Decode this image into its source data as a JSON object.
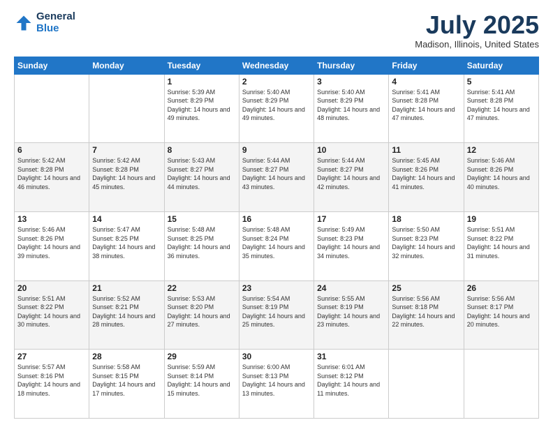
{
  "header": {
    "logo": {
      "general": "General",
      "blue": "Blue"
    },
    "title": "July 2025",
    "location": "Madison, Illinois, United States"
  },
  "days_of_week": [
    "Sunday",
    "Monday",
    "Tuesday",
    "Wednesday",
    "Thursday",
    "Friday",
    "Saturday"
  ],
  "weeks": [
    [
      {
        "day": "",
        "info": ""
      },
      {
        "day": "",
        "info": ""
      },
      {
        "day": "1",
        "info": "Sunrise: 5:39 AM\nSunset: 8:29 PM\nDaylight: 14 hours and 49 minutes."
      },
      {
        "day": "2",
        "info": "Sunrise: 5:40 AM\nSunset: 8:29 PM\nDaylight: 14 hours and 49 minutes."
      },
      {
        "day": "3",
        "info": "Sunrise: 5:40 AM\nSunset: 8:29 PM\nDaylight: 14 hours and 48 minutes."
      },
      {
        "day": "4",
        "info": "Sunrise: 5:41 AM\nSunset: 8:28 PM\nDaylight: 14 hours and 47 minutes."
      },
      {
        "day": "5",
        "info": "Sunrise: 5:41 AM\nSunset: 8:28 PM\nDaylight: 14 hours and 47 minutes."
      }
    ],
    [
      {
        "day": "6",
        "info": "Sunrise: 5:42 AM\nSunset: 8:28 PM\nDaylight: 14 hours and 46 minutes."
      },
      {
        "day": "7",
        "info": "Sunrise: 5:42 AM\nSunset: 8:28 PM\nDaylight: 14 hours and 45 minutes."
      },
      {
        "day": "8",
        "info": "Sunrise: 5:43 AM\nSunset: 8:27 PM\nDaylight: 14 hours and 44 minutes."
      },
      {
        "day": "9",
        "info": "Sunrise: 5:44 AM\nSunset: 8:27 PM\nDaylight: 14 hours and 43 minutes."
      },
      {
        "day": "10",
        "info": "Sunrise: 5:44 AM\nSunset: 8:27 PM\nDaylight: 14 hours and 42 minutes."
      },
      {
        "day": "11",
        "info": "Sunrise: 5:45 AM\nSunset: 8:26 PM\nDaylight: 14 hours and 41 minutes."
      },
      {
        "day": "12",
        "info": "Sunrise: 5:46 AM\nSunset: 8:26 PM\nDaylight: 14 hours and 40 minutes."
      }
    ],
    [
      {
        "day": "13",
        "info": "Sunrise: 5:46 AM\nSunset: 8:26 PM\nDaylight: 14 hours and 39 minutes."
      },
      {
        "day": "14",
        "info": "Sunrise: 5:47 AM\nSunset: 8:25 PM\nDaylight: 14 hours and 38 minutes."
      },
      {
        "day": "15",
        "info": "Sunrise: 5:48 AM\nSunset: 8:25 PM\nDaylight: 14 hours and 36 minutes."
      },
      {
        "day": "16",
        "info": "Sunrise: 5:48 AM\nSunset: 8:24 PM\nDaylight: 14 hours and 35 minutes."
      },
      {
        "day": "17",
        "info": "Sunrise: 5:49 AM\nSunset: 8:23 PM\nDaylight: 14 hours and 34 minutes."
      },
      {
        "day": "18",
        "info": "Sunrise: 5:50 AM\nSunset: 8:23 PM\nDaylight: 14 hours and 32 minutes."
      },
      {
        "day": "19",
        "info": "Sunrise: 5:51 AM\nSunset: 8:22 PM\nDaylight: 14 hours and 31 minutes."
      }
    ],
    [
      {
        "day": "20",
        "info": "Sunrise: 5:51 AM\nSunset: 8:22 PM\nDaylight: 14 hours and 30 minutes."
      },
      {
        "day": "21",
        "info": "Sunrise: 5:52 AM\nSunset: 8:21 PM\nDaylight: 14 hours and 28 minutes."
      },
      {
        "day": "22",
        "info": "Sunrise: 5:53 AM\nSunset: 8:20 PM\nDaylight: 14 hours and 27 minutes."
      },
      {
        "day": "23",
        "info": "Sunrise: 5:54 AM\nSunset: 8:19 PM\nDaylight: 14 hours and 25 minutes."
      },
      {
        "day": "24",
        "info": "Sunrise: 5:55 AM\nSunset: 8:19 PM\nDaylight: 14 hours and 23 minutes."
      },
      {
        "day": "25",
        "info": "Sunrise: 5:56 AM\nSunset: 8:18 PM\nDaylight: 14 hours and 22 minutes."
      },
      {
        "day": "26",
        "info": "Sunrise: 5:56 AM\nSunset: 8:17 PM\nDaylight: 14 hours and 20 minutes."
      }
    ],
    [
      {
        "day": "27",
        "info": "Sunrise: 5:57 AM\nSunset: 8:16 PM\nDaylight: 14 hours and 18 minutes."
      },
      {
        "day": "28",
        "info": "Sunrise: 5:58 AM\nSunset: 8:15 PM\nDaylight: 14 hours and 17 minutes."
      },
      {
        "day": "29",
        "info": "Sunrise: 5:59 AM\nSunset: 8:14 PM\nDaylight: 14 hours and 15 minutes."
      },
      {
        "day": "30",
        "info": "Sunrise: 6:00 AM\nSunset: 8:13 PM\nDaylight: 14 hours and 13 minutes."
      },
      {
        "day": "31",
        "info": "Sunrise: 6:01 AM\nSunset: 8:12 PM\nDaylight: 14 hours and 11 minutes."
      },
      {
        "day": "",
        "info": ""
      },
      {
        "day": "",
        "info": ""
      }
    ]
  ]
}
